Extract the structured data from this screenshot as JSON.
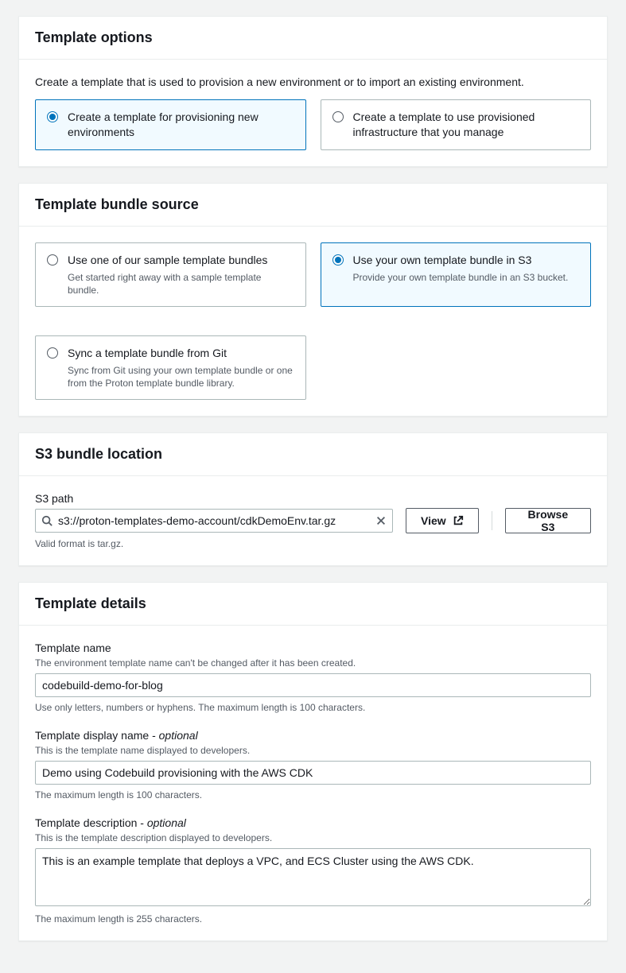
{
  "templateOptions": {
    "title": "Template options",
    "intro": "Create a template that is used to provision a new environment or to import an existing environment.",
    "choices": [
      {
        "label": "Create a template for provisioning new environments"
      },
      {
        "label": "Create a template to use provisioned infrastructure that you manage"
      }
    ]
  },
  "bundleSource": {
    "title": "Template bundle source",
    "choices": [
      {
        "label": "Use one of our sample template bundles",
        "desc": "Get started right away with a sample template bundle."
      },
      {
        "label": "Use your own template bundle in S3",
        "desc": "Provide your own template bundle in an S3 bucket."
      },
      {
        "label": "Sync a template bundle from Git",
        "desc": "Sync from Git using your own template bundle or one from the Proton template bundle library."
      }
    ]
  },
  "s3Location": {
    "title": "S3 bundle location",
    "pathLabel": "S3 path",
    "pathValue": "s3://proton-templates-demo-account/cdkDemoEnv.tar.gz",
    "hint": "Valid format is tar.gz.",
    "viewLabel": "View",
    "browseLabel": "Browse S3"
  },
  "templateDetails": {
    "title": "Template details",
    "name": {
      "label": "Template name",
      "sub": "The environment template name can't be changed after it has been created.",
      "value": "codebuild-demo-for-blog",
      "hint": "Use only letters, numbers or hyphens. The maximum length is 100 characters."
    },
    "displayName": {
      "labelPrefix": "Template display name - ",
      "labelSuffix": "optional",
      "sub": "This is the template name displayed to developers.",
      "value": "Demo using Codebuild provisioning with the AWS CDK",
      "hint": "The maximum length is 100 characters."
    },
    "description": {
      "labelPrefix": "Template description - ",
      "labelSuffix": "optional",
      "sub": "This is the template description displayed to developers.",
      "value": "This is an example template that deploys a VPC, and ECS Cluster using the AWS CDK.",
      "hint": "The maximum length is 255 characters."
    }
  }
}
